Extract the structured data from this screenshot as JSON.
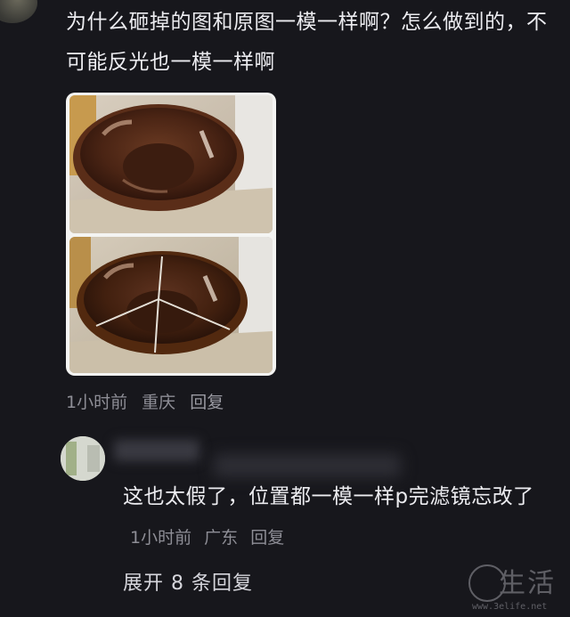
{
  "comment": {
    "text": "为什么砸掉的图和原图一模一样啊？怎么做到的，不可能反光也一模一样啊",
    "meta": {
      "time": "1小时前",
      "location": "重庆",
      "reply_label": "回复"
    }
  },
  "reply": {
    "text": "这也太假了，位置都一模一样p完滤镜忘改了",
    "meta": {
      "time": "1小时前",
      "location": "广东",
      "reply_label": "回复"
    }
  },
  "expand_label": "展开 8 条回复",
  "watermark": {
    "chars": "生活",
    "url": "www.3elife.net"
  },
  "colors": {
    "background": "#17171c",
    "text": "#ececf0",
    "meta": "#8e8e96"
  }
}
